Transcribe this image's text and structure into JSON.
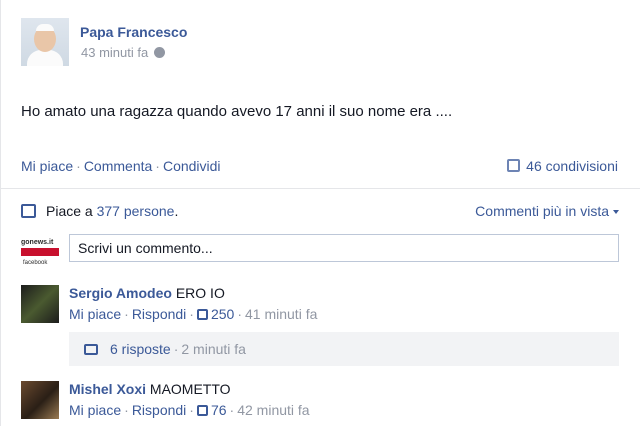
{
  "post": {
    "author": "Papa Francesco",
    "time": "43 minuti fa",
    "message": "Ho amato una ragazza quando avevo 17 anni il suo nome era ....",
    "actions": {
      "like": "Mi piace",
      "comment": "Commenta",
      "share": "Condividi"
    },
    "shares": "46 condivisioni"
  },
  "ufi": {
    "likes_prefix": "Piace a",
    "likes_link": "377 persone",
    "likes_suffix": ".",
    "sort_label": "Commenti più in vista",
    "composer_placeholder": "Scrivi un commento...",
    "composer_avatar": {
      "brand": "gonews.it",
      "sub": "facebook"
    }
  },
  "comments": [
    {
      "name": "Sergio Amodeo",
      "text": "ERO IO",
      "like": "Mi piace",
      "reply": "Rispondi",
      "likes": "250",
      "time": "41 minuti fa",
      "replies": {
        "count": "6 risposte",
        "time": "2 minuti fa"
      }
    },
    {
      "name": "Mishel Xoxi",
      "text": "MAOMETTO",
      "like": "Mi piace",
      "reply": "Rispondi",
      "likes": "76",
      "time": "42 minuti fa"
    }
  ],
  "colors": {
    "link": "#3b5998",
    "meta": "#9197a3",
    "text": "#141823"
  },
  "icons": {
    "privacy": "globe-icon",
    "shares": "share-icon",
    "likes": "thumbs-up-icon",
    "sort": "caret-down-icon",
    "replies": "reply-bubble-icon"
  }
}
